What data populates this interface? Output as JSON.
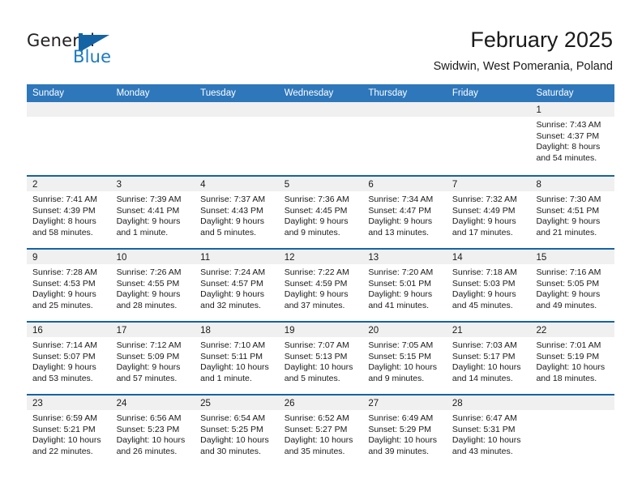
{
  "brand": {
    "name_part1": "General",
    "name_part2": "Blue",
    "accent_color": "#1c7ac0",
    "mark_color": "#1464a5"
  },
  "header": {
    "title": "February 2025",
    "location": "Swidwin, West Pomerania, Poland"
  },
  "calendar": {
    "header_bg": "#2e77bb",
    "row_divider_color": "#1464a5",
    "daynum_strip_bg": "#f0f0f0",
    "weekday_headers": [
      "Sunday",
      "Monday",
      "Tuesday",
      "Wednesday",
      "Thursday",
      "Friday",
      "Saturday"
    ],
    "weeks": [
      [
        {
          "day": "",
          "sunrise": "",
          "sunset": "",
          "daylight_line1": "",
          "daylight_line2": ""
        },
        {
          "day": "",
          "sunrise": "",
          "sunset": "",
          "daylight_line1": "",
          "daylight_line2": ""
        },
        {
          "day": "",
          "sunrise": "",
          "sunset": "",
          "daylight_line1": "",
          "daylight_line2": ""
        },
        {
          "day": "",
          "sunrise": "",
          "sunset": "",
          "daylight_line1": "",
          "daylight_line2": ""
        },
        {
          "day": "",
          "sunrise": "",
          "sunset": "",
          "daylight_line1": "",
          "daylight_line2": ""
        },
        {
          "day": "",
          "sunrise": "",
          "sunset": "",
          "daylight_line1": "",
          "daylight_line2": ""
        },
        {
          "day": "1",
          "sunrise": "Sunrise: 7:43 AM",
          "sunset": "Sunset: 4:37 PM",
          "daylight_line1": "Daylight: 8 hours",
          "daylight_line2": "and 54 minutes."
        }
      ],
      [
        {
          "day": "2",
          "sunrise": "Sunrise: 7:41 AM",
          "sunset": "Sunset: 4:39 PM",
          "daylight_line1": "Daylight: 8 hours",
          "daylight_line2": "and 58 minutes."
        },
        {
          "day": "3",
          "sunrise": "Sunrise: 7:39 AM",
          "sunset": "Sunset: 4:41 PM",
          "daylight_line1": "Daylight: 9 hours",
          "daylight_line2": "and 1 minute."
        },
        {
          "day": "4",
          "sunrise": "Sunrise: 7:37 AM",
          "sunset": "Sunset: 4:43 PM",
          "daylight_line1": "Daylight: 9 hours",
          "daylight_line2": "and 5 minutes."
        },
        {
          "day": "5",
          "sunrise": "Sunrise: 7:36 AM",
          "sunset": "Sunset: 4:45 PM",
          "daylight_line1": "Daylight: 9 hours",
          "daylight_line2": "and 9 minutes."
        },
        {
          "day": "6",
          "sunrise": "Sunrise: 7:34 AM",
          "sunset": "Sunset: 4:47 PM",
          "daylight_line1": "Daylight: 9 hours",
          "daylight_line2": "and 13 minutes."
        },
        {
          "day": "7",
          "sunrise": "Sunrise: 7:32 AM",
          "sunset": "Sunset: 4:49 PM",
          "daylight_line1": "Daylight: 9 hours",
          "daylight_line2": "and 17 minutes."
        },
        {
          "day": "8",
          "sunrise": "Sunrise: 7:30 AM",
          "sunset": "Sunset: 4:51 PM",
          "daylight_line1": "Daylight: 9 hours",
          "daylight_line2": "and 21 minutes."
        }
      ],
      [
        {
          "day": "9",
          "sunrise": "Sunrise: 7:28 AM",
          "sunset": "Sunset: 4:53 PM",
          "daylight_line1": "Daylight: 9 hours",
          "daylight_line2": "and 25 minutes."
        },
        {
          "day": "10",
          "sunrise": "Sunrise: 7:26 AM",
          "sunset": "Sunset: 4:55 PM",
          "daylight_line1": "Daylight: 9 hours",
          "daylight_line2": "and 28 minutes."
        },
        {
          "day": "11",
          "sunrise": "Sunrise: 7:24 AM",
          "sunset": "Sunset: 4:57 PM",
          "daylight_line1": "Daylight: 9 hours",
          "daylight_line2": "and 32 minutes."
        },
        {
          "day": "12",
          "sunrise": "Sunrise: 7:22 AM",
          "sunset": "Sunset: 4:59 PM",
          "daylight_line1": "Daylight: 9 hours",
          "daylight_line2": "and 37 minutes."
        },
        {
          "day": "13",
          "sunrise": "Sunrise: 7:20 AM",
          "sunset": "Sunset: 5:01 PM",
          "daylight_line1": "Daylight: 9 hours",
          "daylight_line2": "and 41 minutes."
        },
        {
          "day": "14",
          "sunrise": "Sunrise: 7:18 AM",
          "sunset": "Sunset: 5:03 PM",
          "daylight_line1": "Daylight: 9 hours",
          "daylight_line2": "and 45 minutes."
        },
        {
          "day": "15",
          "sunrise": "Sunrise: 7:16 AM",
          "sunset": "Sunset: 5:05 PM",
          "daylight_line1": "Daylight: 9 hours",
          "daylight_line2": "and 49 minutes."
        }
      ],
      [
        {
          "day": "16",
          "sunrise": "Sunrise: 7:14 AM",
          "sunset": "Sunset: 5:07 PM",
          "daylight_line1": "Daylight: 9 hours",
          "daylight_line2": "and 53 minutes."
        },
        {
          "day": "17",
          "sunrise": "Sunrise: 7:12 AM",
          "sunset": "Sunset: 5:09 PM",
          "daylight_line1": "Daylight: 9 hours",
          "daylight_line2": "and 57 minutes."
        },
        {
          "day": "18",
          "sunrise": "Sunrise: 7:10 AM",
          "sunset": "Sunset: 5:11 PM",
          "daylight_line1": "Daylight: 10 hours",
          "daylight_line2": "and 1 minute."
        },
        {
          "day": "19",
          "sunrise": "Sunrise: 7:07 AM",
          "sunset": "Sunset: 5:13 PM",
          "daylight_line1": "Daylight: 10 hours",
          "daylight_line2": "and 5 minutes."
        },
        {
          "day": "20",
          "sunrise": "Sunrise: 7:05 AM",
          "sunset": "Sunset: 5:15 PM",
          "daylight_line1": "Daylight: 10 hours",
          "daylight_line2": "and 9 minutes."
        },
        {
          "day": "21",
          "sunrise": "Sunrise: 7:03 AM",
          "sunset": "Sunset: 5:17 PM",
          "daylight_line1": "Daylight: 10 hours",
          "daylight_line2": "and 14 minutes."
        },
        {
          "day": "22",
          "sunrise": "Sunrise: 7:01 AM",
          "sunset": "Sunset: 5:19 PM",
          "daylight_line1": "Daylight: 10 hours",
          "daylight_line2": "and 18 minutes."
        }
      ],
      [
        {
          "day": "23",
          "sunrise": "Sunrise: 6:59 AM",
          "sunset": "Sunset: 5:21 PM",
          "daylight_line1": "Daylight: 10 hours",
          "daylight_line2": "and 22 minutes."
        },
        {
          "day": "24",
          "sunrise": "Sunrise: 6:56 AM",
          "sunset": "Sunset: 5:23 PM",
          "daylight_line1": "Daylight: 10 hours",
          "daylight_line2": "and 26 minutes."
        },
        {
          "day": "25",
          "sunrise": "Sunrise: 6:54 AM",
          "sunset": "Sunset: 5:25 PM",
          "daylight_line1": "Daylight: 10 hours",
          "daylight_line2": "and 30 minutes."
        },
        {
          "day": "26",
          "sunrise": "Sunrise: 6:52 AM",
          "sunset": "Sunset: 5:27 PM",
          "daylight_line1": "Daylight: 10 hours",
          "daylight_line2": "and 35 minutes."
        },
        {
          "day": "27",
          "sunrise": "Sunrise: 6:49 AM",
          "sunset": "Sunset: 5:29 PM",
          "daylight_line1": "Daylight: 10 hours",
          "daylight_line2": "and 39 minutes."
        },
        {
          "day": "28",
          "sunrise": "Sunrise: 6:47 AM",
          "sunset": "Sunset: 5:31 PM",
          "daylight_line1": "Daylight: 10 hours",
          "daylight_line2": "and 43 minutes."
        },
        {
          "day": "",
          "sunrise": "",
          "sunset": "",
          "daylight_line1": "",
          "daylight_line2": ""
        }
      ]
    ]
  }
}
